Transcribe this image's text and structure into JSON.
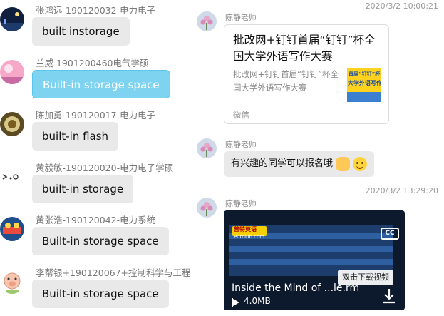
{
  "left_chat": {
    "messages": [
      {
        "sender": "张鸿远-190120032-电力电子",
        "text": "built instorage",
        "avatar_icon": "avatar-night-scene-icon"
      },
      {
        "sender": "兰威 1901200460电气学硕",
        "text": "Built-in storage space",
        "avatar_icon": "avatar-pink-sky-icon"
      },
      {
        "sender": "陈加勇-190120017-电力电子",
        "text": "built-in flash",
        "avatar_icon": "avatar-coffee-cup-icon"
      },
      {
        "sender": "黄毅敏-190120020-电力电子学硕",
        "text": "built-in storage",
        "avatar_icon": "avatar-face-doodle-icon"
      },
      {
        "sender": "黄张浩-190120042-电力系统",
        "text": "Built-in storage space",
        "avatar_icon": "avatar-cartoon-icon"
      },
      {
        "sender": "李帮银+190120067+控制科学与工程",
        "text": "Built-in storage space",
        "avatar_icon": "avatar-pig-icon"
      }
    ]
  },
  "right_chat": {
    "timestamp_1": "2020/3/2 10:00:21",
    "timestamp_2": "2020/3/2 13:29:20",
    "teacher_name": "陈静老师",
    "link_card": {
      "title": "批改网+钉钉首届“钉钉”杯全国大学外语写作大赛",
      "description": "批改网+钉钉首届“钉钉”杯全国大学外语写作大赛",
      "thumb_line1": "首届“钉钉”杯",
      "thumb_line2": "大学外语写作",
      "source": "微信"
    },
    "text_message": {
      "text": "有兴趣的同学可以报名哦",
      "emojis": [
        "fist-emoji-icon",
        "smile-emoji-icon"
      ]
    },
    "video": {
      "brand": "普特英语",
      "brand_site": "Putclub.com",
      "cc_label": "CC",
      "hint": "双击下载视频",
      "file_name": "Inside the Mind of ...le.rm",
      "file_size": "4.0MB"
    }
  },
  "colors": {
    "bubble_gray": "#e9e9e9",
    "bubble_selected": "#7ed3f0",
    "timestamp": "#999999"
  }
}
